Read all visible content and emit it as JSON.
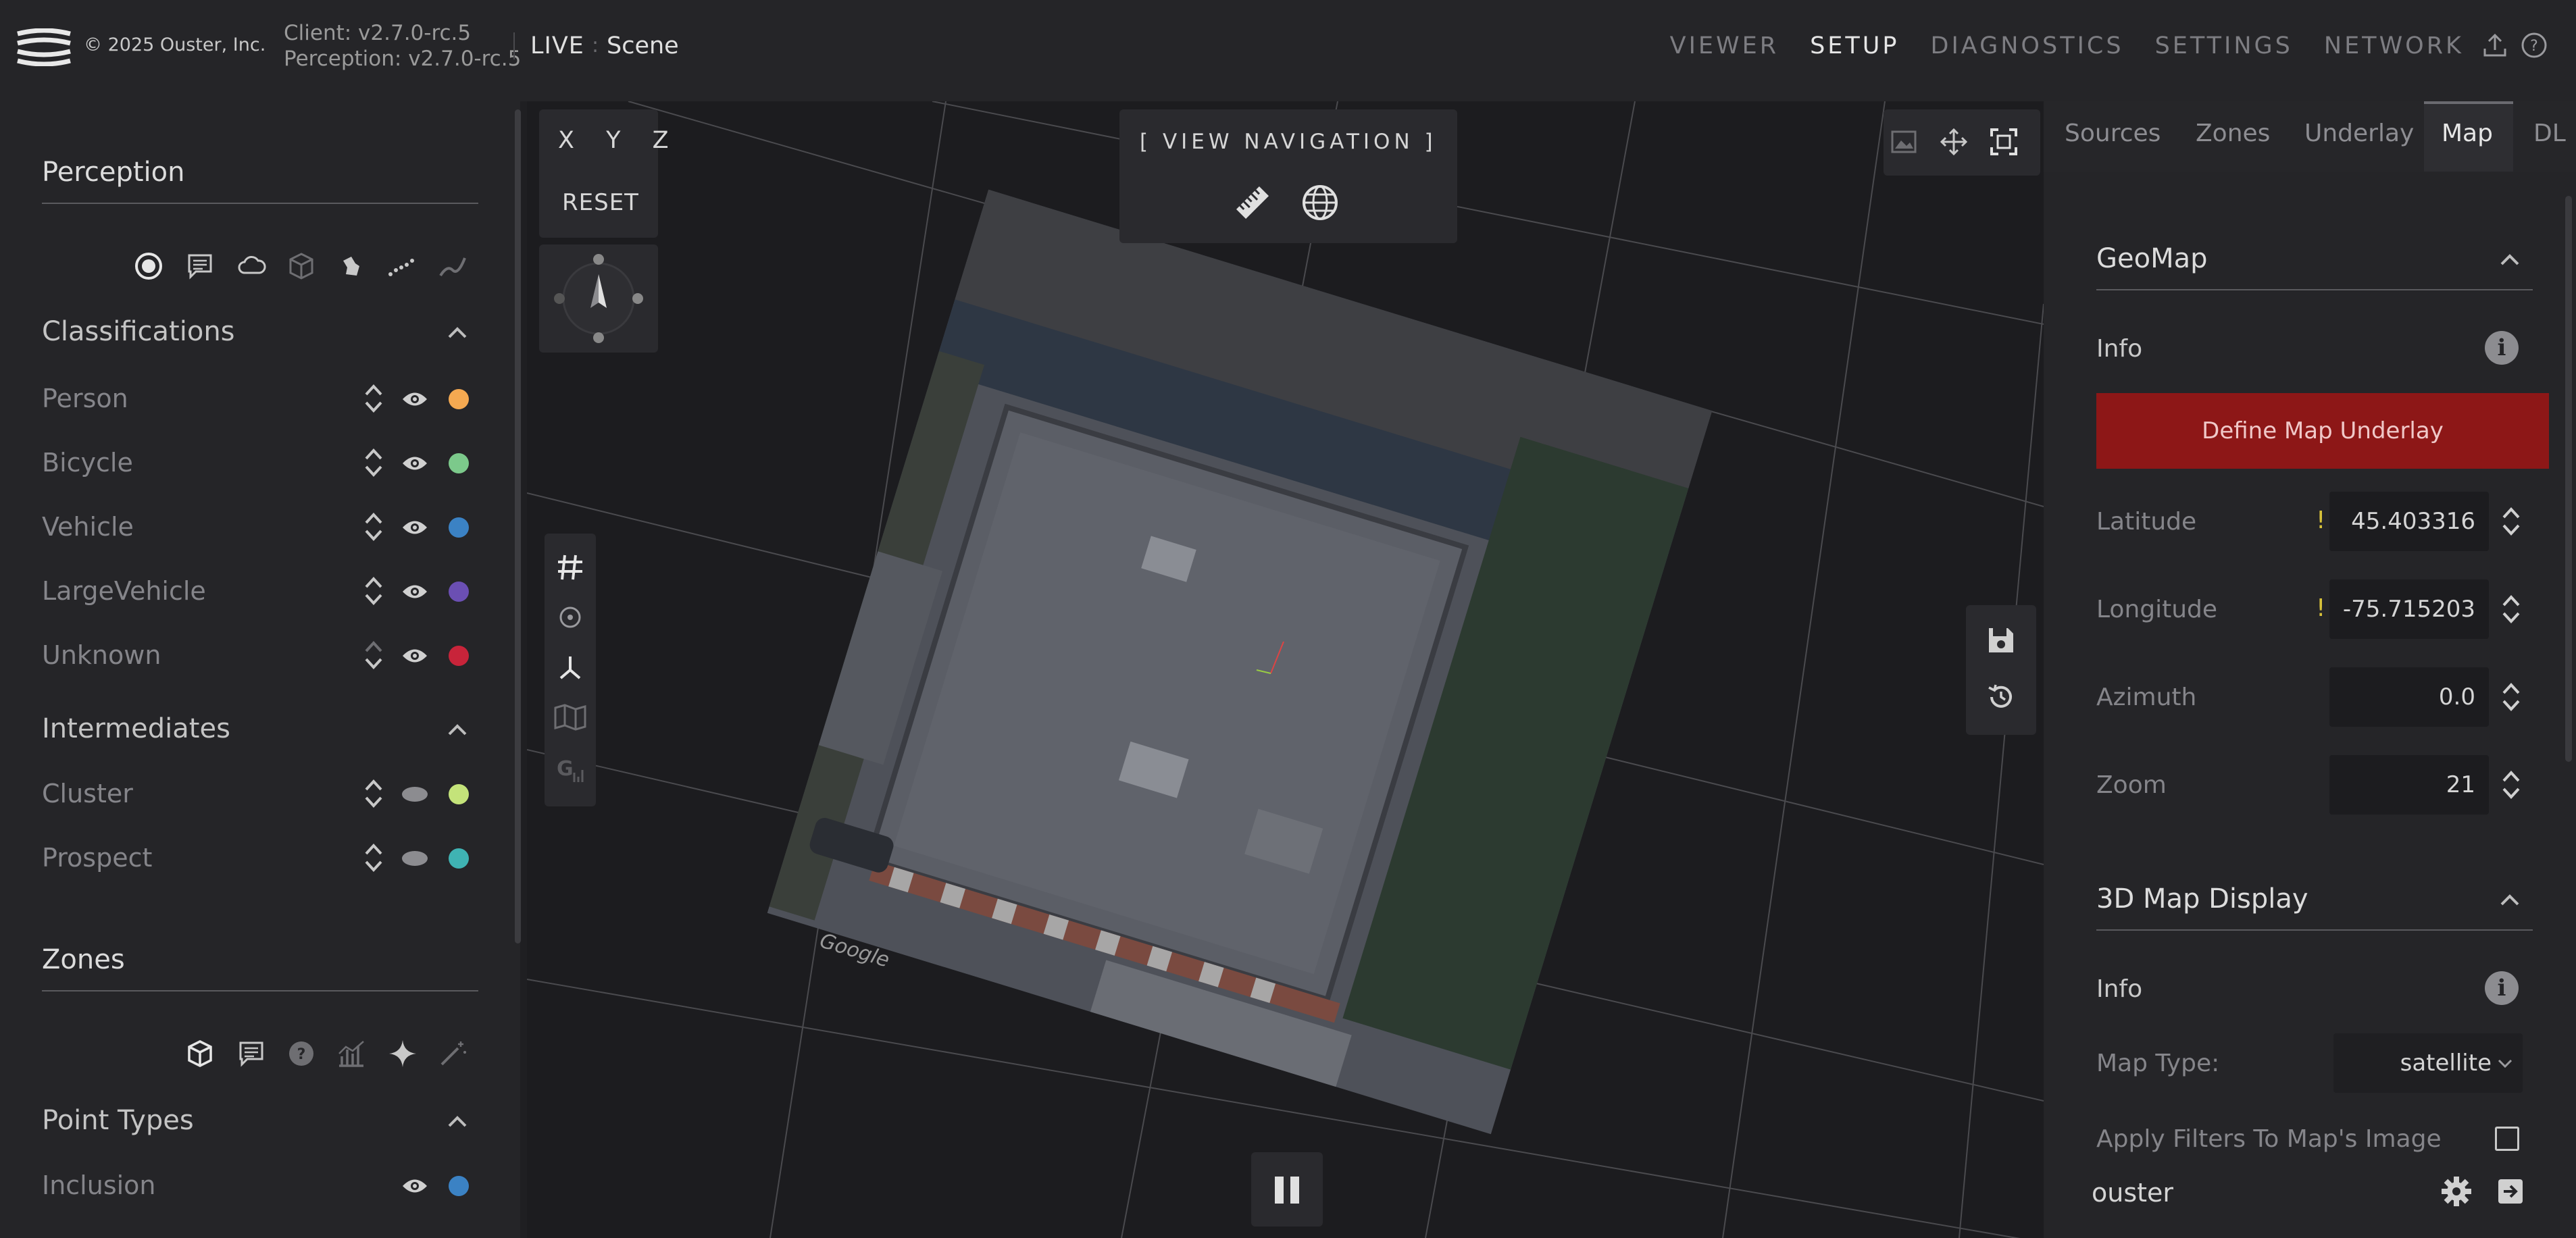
{
  "header": {
    "copyright": "© 2025 Ouster, Inc.",
    "client_version": "Client: v2.7.0-rc.5",
    "perception_version": "Perception: v2.7.0-rc.5",
    "mode": "LIVE",
    "context": "Scene",
    "nav": [
      "VIEWER",
      "SETUP",
      "DIAGNOSTICS",
      "SETTINGS",
      "NETWORK"
    ],
    "active_nav": "SETUP",
    "icons": [
      "upload-icon",
      "help-icon"
    ]
  },
  "left_panel": {
    "perception": {
      "title": "Perception",
      "tool_icons": [
        "target-icon",
        "label-icon",
        "cloud-icon",
        "cube-icon",
        "blob-icon",
        "dotted-trail-icon",
        "trail-curve-icon"
      ],
      "classifications": {
        "title": "Classifications",
        "items": [
          {
            "label": "Person",
            "color": "#f5a951"
          },
          {
            "label": "Bicycle",
            "color": "#7cc98b"
          },
          {
            "label": "Vehicle",
            "color": "#3b82c4"
          },
          {
            "label": "LargeVehicle",
            "color": "#6b4fb3"
          },
          {
            "label": "Unknown",
            "color": "#c8243a"
          }
        ]
      },
      "intermediates": {
        "title": "Intermediates",
        "items": [
          {
            "label": "Cluster",
            "color": "#c4e37a"
          },
          {
            "label": "Prospect",
            "color": "#3fb3b3"
          }
        ]
      }
    },
    "zones": {
      "title": "Zones",
      "tool_icons": [
        "cube-outline-icon",
        "label-icon",
        "question-icon",
        "chart-icon",
        "sparkle-icon",
        "magic-wand-icon"
      ],
      "point_types": {
        "title": "Point Types",
        "items": [
          {
            "label": "Inclusion",
            "color": "#3b82c4"
          }
        ]
      }
    }
  },
  "viewport": {
    "axes_label": "X Y Z",
    "reset_label": "RESET",
    "view_nav_label": "[ VIEW NAVIGATION ]",
    "view_nav_icons": [
      "ruler-icon",
      "globe-icon"
    ],
    "left_tools": [
      "grid-icon",
      "target-icon",
      "axes-icon",
      "map-icon",
      "google-g-icon"
    ],
    "right_tools_top": [
      "image-icon",
      "move-icon",
      "fit-screen-icon"
    ],
    "right_tools_side": [
      "save-icon",
      "history-icon"
    ],
    "map_watermark": "Google",
    "playback": "pause-icon"
  },
  "right_panel": {
    "tabs": [
      "Sources",
      "Zones",
      "Underlay",
      "Map",
      "DL"
    ],
    "active_tab": "Map",
    "geomap": {
      "title": "GeoMap",
      "info_label": "Info",
      "define_button": "Define Map Underlay",
      "fields": [
        {
          "label": "Latitude",
          "value": "45.403316",
          "warning": "!"
        },
        {
          "label": "Longitude",
          "value": "-75.715203",
          "warning": "!"
        },
        {
          "label": "Azimuth",
          "value": "0.0"
        },
        {
          "label": "Zoom",
          "value": "21"
        }
      ]
    },
    "map_display": {
      "title": "3D Map Display",
      "info_label": "Info",
      "map_type_label": "Map Type:",
      "map_type_value": "satellite",
      "apply_filters_label": "Apply Filters To Map's Image"
    },
    "footer": {
      "username": "ouster",
      "icons": [
        "gear-icon",
        "logout-icon"
      ]
    }
  },
  "colors": {
    "accent_red": "#8d1717",
    "warning": "#d8c23a",
    "panel_bg": "#252528",
    "viewport_bg": "#1c1c1f"
  }
}
